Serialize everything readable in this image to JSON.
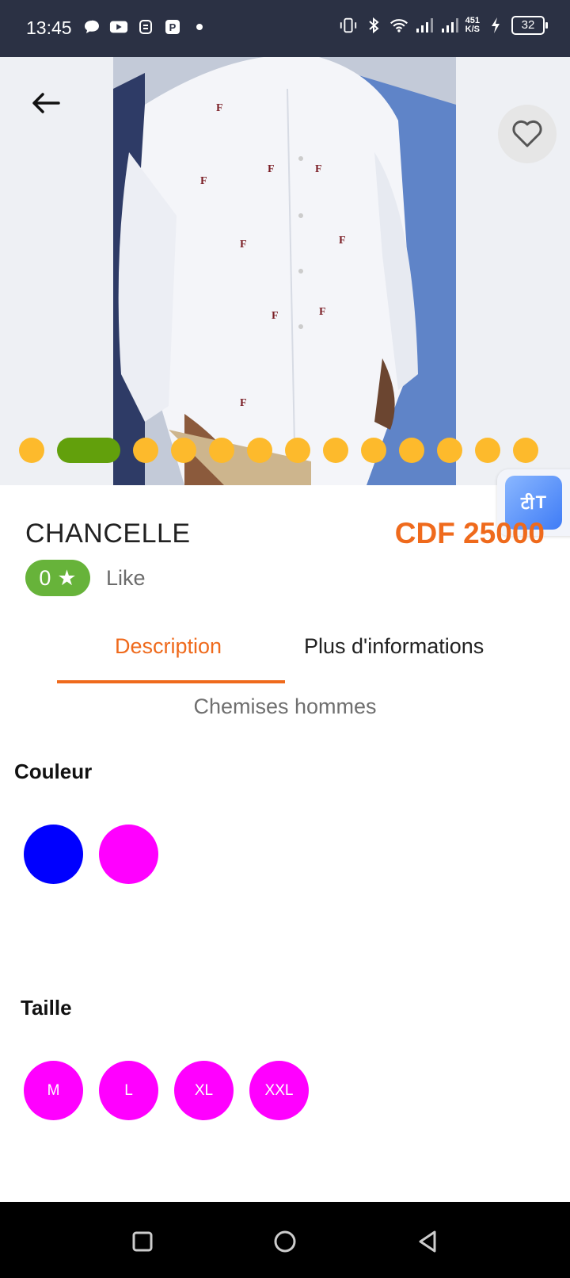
{
  "status_bar": {
    "time": "13:45",
    "left_icons": [
      "chat-bubble-icon",
      "youtube-icon",
      "app-icon",
      "parking-icon",
      "dot-icon"
    ],
    "net_speed_value": "451",
    "net_speed_unit": "K/S",
    "battery": "32"
  },
  "hero": {
    "image_count": 13,
    "active_index": 1
  },
  "product": {
    "name": "CHANCELLE",
    "price": "CDF 25000",
    "rating": "0",
    "like_label": "Like"
  },
  "tabs": {
    "description": "Description",
    "more_info": "Plus d'informations",
    "active": "description"
  },
  "category": "Chemises hommes",
  "colors": {
    "label": "Couleur",
    "swatches": [
      "#0000ff",
      "#ff00ff"
    ]
  },
  "sizes": {
    "label": "Taille",
    "options": [
      "M",
      "L",
      "XL",
      "XXL"
    ],
    "chip_color": "#ff00ff"
  },
  "translate_badge": {
    "glyph_left": "टी",
    "glyph_right": "T"
  },
  "accent_color": "#ef6a1c"
}
